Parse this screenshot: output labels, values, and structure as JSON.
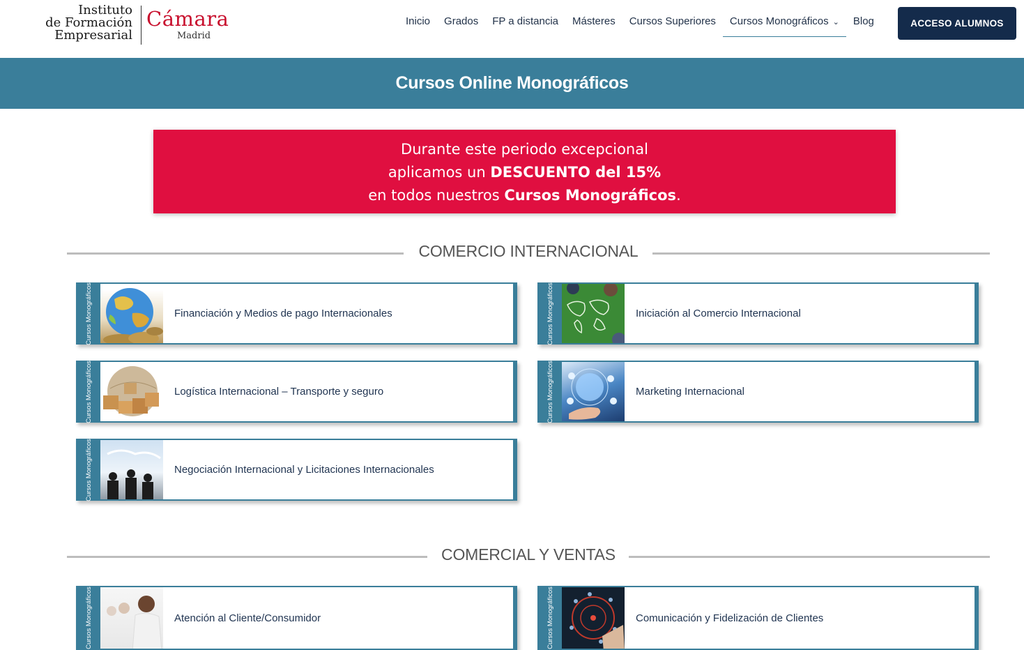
{
  "logo": {
    "ife_lines": [
      "Instituto",
      "de Formación",
      "Empresarial"
    ],
    "camara": "Cámara",
    "madrid": "Madrid"
  },
  "nav": {
    "items": [
      "Inicio",
      "Grados",
      "FP a distancia",
      "Másteres",
      "Cursos Superiores",
      "Cursos Monográficos",
      "Blog"
    ],
    "active_index": 5,
    "cta": "ACCESO ALUMNOS"
  },
  "banner": {
    "title": "Cursos Online Monográficos"
  },
  "promo": {
    "line1": "Durante este periodo excepcional",
    "line2_pre": "aplicamos un ",
    "line2_bold": "DESCUENTO del 15%",
    "line3_pre": "en todos nuestros ",
    "line3_bold": "Cursos Monográficos",
    "line3_post": "."
  },
  "card_tag": "Cursos Monográficos",
  "sections": [
    {
      "title": "COMERCIO INTERNACIONAL",
      "courses": [
        {
          "title": "Financiación y Medios de pago Internacionales",
          "image": "globe-coins-image"
        },
        {
          "title": "Iniciación al Comercio Internacional",
          "image": "world-map-board-image"
        },
        {
          "title": "Logística Internacional – Transporte y seguro",
          "image": "globe-boxes-image"
        },
        {
          "title": "Marketing Internacional",
          "image": "hand-digital-globe-image"
        },
        {
          "title": "Negociación Internacional y Licitaciones Internacionales",
          "image": "business-meeting-image"
        }
      ]
    },
    {
      "title": "COMERCIAL Y VENTAS",
      "courses": [
        {
          "title": "Atención al Cliente/Consumidor",
          "image": "call-center-image"
        },
        {
          "title": "Comunicación y Fidelización de Clientes",
          "image": "customer-network-image"
        }
      ]
    }
  ],
  "colors": {
    "accent": "#3a7e9a",
    "navy": "#142b4b",
    "promo": "#e00f40",
    "brand_red": "#c8102e"
  }
}
